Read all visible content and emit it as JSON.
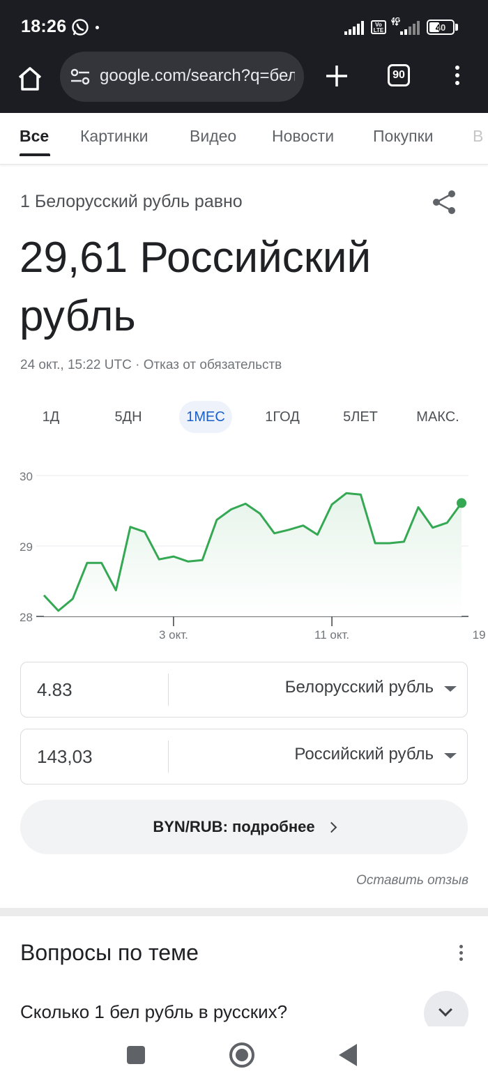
{
  "status_bar": {
    "time": "18:26",
    "volte": "Vo LTE",
    "network": "4G",
    "battery": "40"
  },
  "browser": {
    "url": "google.com/search?q=бел",
    "tab_count": "90"
  },
  "search_tabs": [
    "Все",
    "Картинки",
    "Видео",
    "Новости",
    "Покупки",
    "В"
  ],
  "result": {
    "label": "1 Белорусский рубль равно",
    "value": "29,61 Российский рубль",
    "meta": "24 окт., 15:22 UTC · Отказ от обязательств",
    "ranges": [
      "1Д",
      "5ДН",
      "1МЕС",
      "1ГОД",
      "5ЛЕТ",
      "МАКС."
    ],
    "active_range": "1МЕС"
  },
  "chart_data": {
    "type": "area",
    "ylim": [
      28,
      30
    ],
    "yticks": [
      "30",
      "29",
      "28"
    ],
    "xticks": [
      {
        "label": "3 окт.",
        "index": 9
      },
      {
        "label": "11 окт.",
        "index": 20
      },
      {
        "label": "19 окт.",
        "index": 31
      }
    ],
    "values": [
      28.3,
      28.08,
      28.25,
      28.76,
      28.76,
      28.37,
      29.27,
      29.2,
      28.81,
      28.85,
      28.78,
      28.8,
      29.37,
      29.52,
      29.6,
      29.46,
      29.18,
      29.23,
      29.29,
      29.16,
      29.59,
      29.75,
      29.73,
      29.04,
      29.04,
      29.06,
      29.55,
      29.26,
      29.33,
      29.61
    ],
    "line_color": "#34a853",
    "fill_color": "#e6f4ea"
  },
  "converter": {
    "from_value": "4.83",
    "from_currency": "Белорусский рубль",
    "to_value": "143,03",
    "to_currency": "Российский рубль"
  },
  "more_button": "BYN/RUB: подробнее",
  "feedback": "Оставить отзыв",
  "related": {
    "title": "Вопросы по теме",
    "question": "Сколько 1 бел рубль в русских?"
  }
}
